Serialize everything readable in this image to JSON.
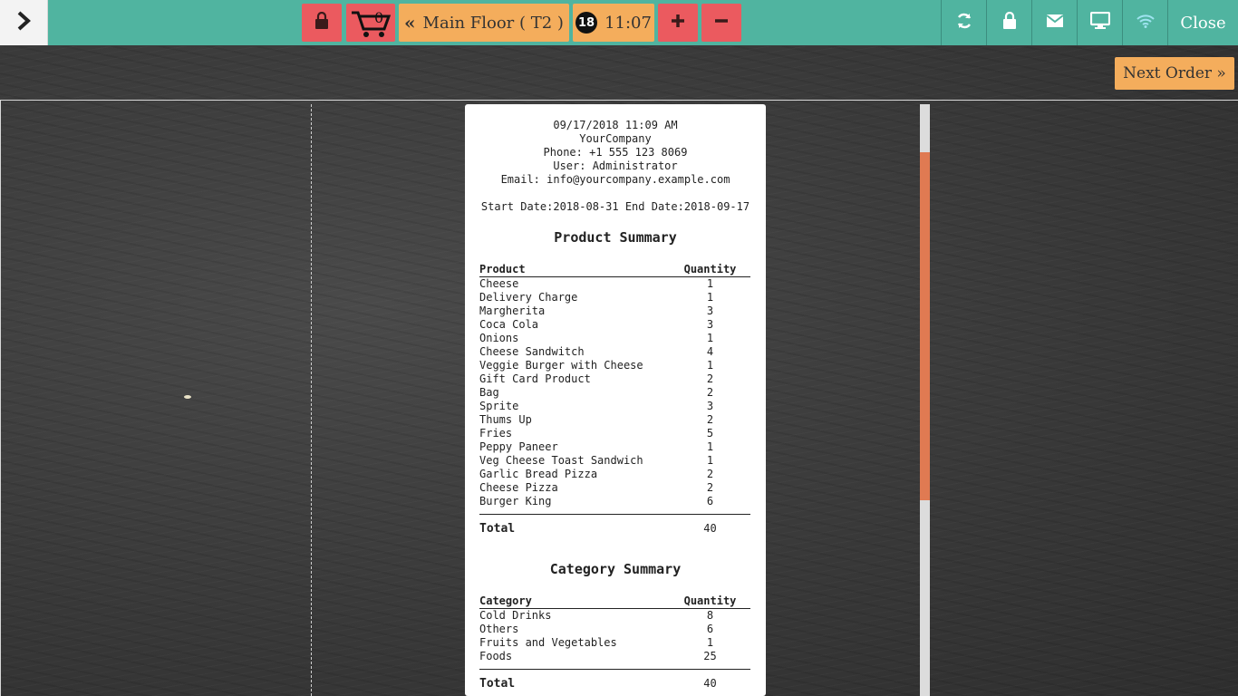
{
  "topbar": {
    "cart_count": "0",
    "floor_label": "Main Floor ( T2 )",
    "orders_count": "18",
    "time": "11:07",
    "close_label": "Close"
  },
  "icons": {
    "toggle": "chevron-right-icon",
    "lock": "lock-icon",
    "cart": "cart-icon",
    "floor_back": "double-chevron-left-icon",
    "plus": "plus-icon",
    "minus": "minus-icon",
    "refresh": "refresh-icon",
    "screen_lock": "lock-icon",
    "mail": "envelope-icon",
    "display": "monitor-icon",
    "wifi": "wifi-icon"
  },
  "colors": {
    "topbar": "#50b4a0",
    "red_button": "#eb5a5f",
    "orange_button": "#f4ad5c",
    "scroll_thumb": "#e07a52"
  },
  "next_order_label": "Next Order »",
  "receipt": {
    "datetime": "09/17/2018 11:09 AM",
    "company": "YourCompany",
    "phone": "Phone: +1 555 123 8069",
    "user": "User: Administrator",
    "email": "Email: info@yourcompany.example.com",
    "date_range": "Start Date:2018-08-31 End Date:2018-09-17",
    "product_summary": {
      "title": "Product Summary",
      "col_product": "Product",
      "col_quantity": "Quantity",
      "rows": [
        {
          "name": "Cheese",
          "qty": "1"
        },
        {
          "name": "Delivery Charge",
          "qty": "1"
        },
        {
          "name": "Margherita",
          "qty": "3"
        },
        {
          "name": "Coca Cola",
          "qty": "3"
        },
        {
          "name": "Onions",
          "qty": "1"
        },
        {
          "name": "Cheese Sandwitch",
          "qty": "4"
        },
        {
          "name": "Veggie Burger with Cheese",
          "qty": "1"
        },
        {
          "name": "Gift Card Product",
          "qty": "2"
        },
        {
          "name": "Bag",
          "qty": "2"
        },
        {
          "name": "Sprite",
          "qty": "3"
        },
        {
          "name": "Thums Up",
          "qty": "2"
        },
        {
          "name": "Fries",
          "qty": "5"
        },
        {
          "name": "Peppy Paneer",
          "qty": "1"
        },
        {
          "name": "Veg Cheese Toast Sandwich",
          "qty": "1"
        },
        {
          "name": "Garlic Bread Pizza",
          "qty": "2"
        },
        {
          "name": "Cheese Pizza",
          "qty": "2"
        },
        {
          "name": "Burger King",
          "qty": "6"
        }
      ],
      "total_label": "Total",
      "total_value": "40"
    },
    "category_summary": {
      "title": "Category Summary",
      "col_category": "Category",
      "col_quantity": "Quantity",
      "rows": [
        {
          "name": "Cold Drinks",
          "qty": "8"
        },
        {
          "name": "Others",
          "qty": "6"
        },
        {
          "name": "Fruits and Vegetables",
          "qty": "1"
        },
        {
          "name": "Foods",
          "qty": "25"
        }
      ],
      "total_label": "Total",
      "total_value": "40"
    }
  }
}
